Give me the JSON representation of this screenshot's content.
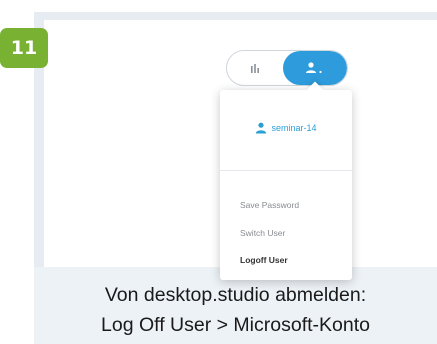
{
  "step": {
    "number": "11"
  },
  "toolbar": {
    "stats_icon": "bar-chart-icon",
    "user_icon": "user-icon",
    "accent_color": "#2e9bdc"
  },
  "user_menu": {
    "username": "seminar-14",
    "items": [
      {
        "label": "Save Password"
      },
      {
        "label": "Switch User"
      },
      {
        "label": "Logoff User"
      }
    ]
  },
  "caption": {
    "line1": "Von desktop.studio abmelden:",
    "line2": "Log Off User > Microsoft-Konto"
  },
  "colors": {
    "badge": "#79b233",
    "frame": "#edf2f7",
    "username": "#2a9fd6"
  }
}
